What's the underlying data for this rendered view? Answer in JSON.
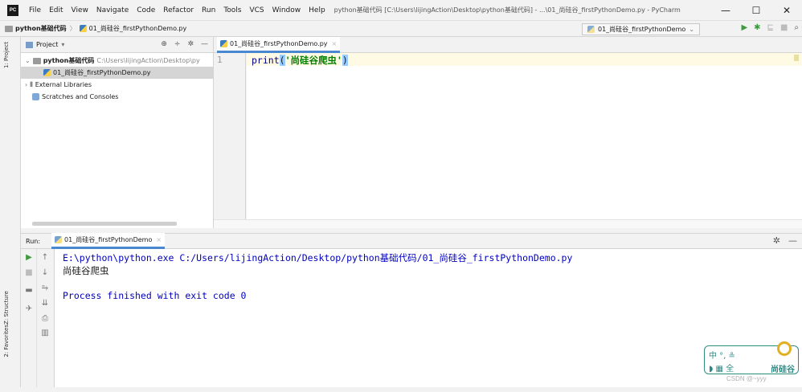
{
  "window": {
    "app_icon": "PC",
    "title": "python基础代码 [C:\\Users\\lijingAction\\Desktop\\python基础代码] - ...\\01_尚硅谷_firstPythonDemo.py - PyCharm",
    "minimize": "—",
    "maximize": "☐",
    "close": "✕"
  },
  "menu": [
    "File",
    "Edit",
    "View",
    "Navigate",
    "Code",
    "Refactor",
    "Run",
    "Tools",
    "VCS",
    "Window",
    "Help"
  ],
  "breadcrumb": {
    "project": "python基础代码",
    "file": "01_尚硅谷_firstPythonDemo.py"
  },
  "run_config": {
    "name": "01_尚硅谷_firstPythonDemo"
  },
  "left_strip": {
    "project_tab": "1: Project",
    "structure_tab": "Z: Structure",
    "favorites_tab": "2: Favorites"
  },
  "project_panel": {
    "title": "Project",
    "tree": [
      {
        "label": "python基础代码",
        "path": "C:\\Users\\lijingAction\\Desktop\\py"
      },
      {
        "label": "01_尚硅谷_firstPythonDemo.py"
      },
      {
        "label": "External Libraries"
      },
      {
        "label": "Scratches and Consoles"
      }
    ]
  },
  "editor": {
    "tab": "01_尚硅谷_firstPythonDemo.py",
    "line_number": "1",
    "code": {
      "func": "print",
      "open": "(",
      "string": "'尚硅谷爬虫'",
      "close": ")"
    }
  },
  "run_panel": {
    "label": "Run:",
    "tab": "01_尚硅谷_firstPythonDemo",
    "console": [
      "E:\\python\\python.exe C:/Users/lijingAction/Desktop/python基础代码/01_尚硅谷_firstPythonDemo.py",
      "尚硅谷爬虫",
      "Process finished with exit code 0"
    ]
  },
  "ime": {
    "line1": "中 °, ≗",
    "line2": "◗ ▦ 全",
    "brand": "尚硅谷"
  },
  "watermark": "CSDN @~yyy",
  "colors": {
    "accent": "#4a87d1",
    "keyword": "#000080",
    "string": "#008000",
    "console_text": "#0000c0",
    "caret_line": "#fffae3",
    "ime_border": "#2f8a86"
  }
}
